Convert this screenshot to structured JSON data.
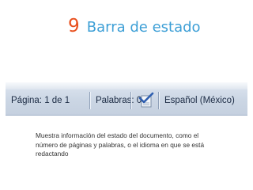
{
  "slide": {
    "number": "9",
    "title": "Barra de estado",
    "description": "Muestra información del estado del documento, como el número de páginas y palabras, o el idioma en que se está redactando"
  },
  "statusbar": {
    "page_info": "Página: 1 de 1",
    "word_count": "Palabras: 0",
    "proofing_icon": "check-document-icon",
    "language": "Español (México)"
  },
  "colors": {
    "number": "#e8501e",
    "title": "#3d9fd6",
    "statusbar_bg": "#cbd6e4",
    "statusbar_text": "#1c2b44"
  }
}
